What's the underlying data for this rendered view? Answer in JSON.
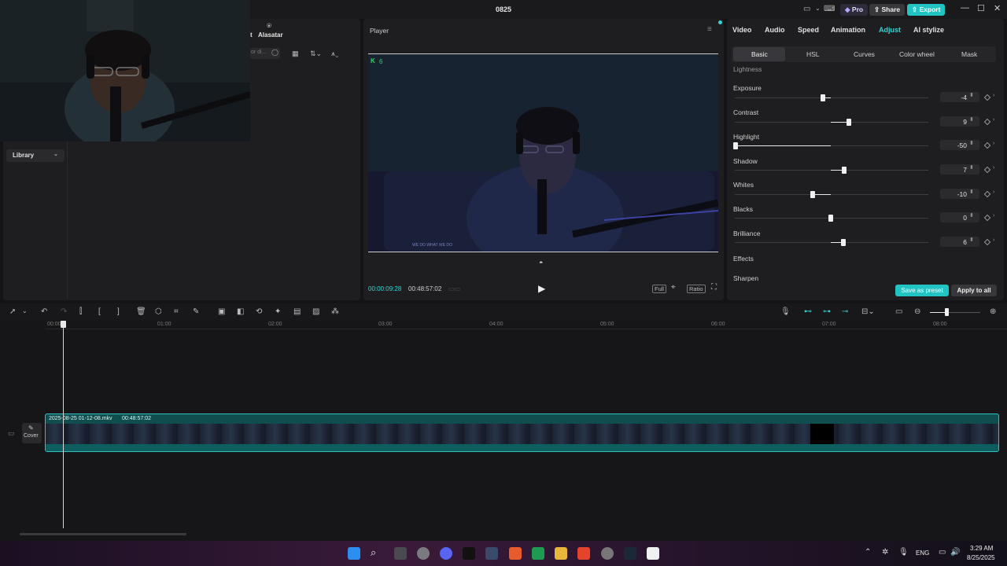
{
  "window": {
    "title": "0825",
    "pro_label": "Pro",
    "share_label": "Share",
    "export_label": "Export"
  },
  "media": {
    "tab_label": "Alasatar",
    "search_placeholder": "or di...",
    "library_label": "Library",
    "partial_tab": "t"
  },
  "player": {
    "title": "Player",
    "marker_count": "6",
    "current_time": "00:00:09:28",
    "total_time": "00:48:57:02",
    "full_label": "Full",
    "ratio_label": "Ratio",
    "watermark_text": "WE DO WHAT WE DO"
  },
  "adjust": {
    "tabs": [
      "Video",
      "Audio",
      "Speed",
      "Animation",
      "Adjust",
      "AI stylize"
    ],
    "active_tab": "Adjust",
    "subtabs": [
      "Basic",
      "HSL",
      "Curves",
      "Color wheel",
      "Mask"
    ],
    "active_subtab": "Basic",
    "section_lightness": "Lightness",
    "params": [
      {
        "label": "Exposure",
        "value": "-4"
      },
      {
        "label": "Contrast",
        "value": "9"
      },
      {
        "label": "Highlight",
        "value": "-50"
      },
      {
        "label": "Shadow",
        "value": "7"
      },
      {
        "label": "Whites",
        "value": "-10"
      },
      {
        "label": "Blacks",
        "value": "0"
      },
      {
        "label": "Brilliance",
        "value": "6"
      }
    ],
    "section_effects": "Effects",
    "sharpen_label": "Sharpen",
    "save_preset_label": "Save as preset",
    "apply_all_label": "Apply to all"
  },
  "timeline": {
    "ruler": [
      "00:00",
      "01:00",
      "02:00",
      "03:00",
      "04:00",
      "05:00",
      "06:00",
      "07:00",
      "08:00"
    ],
    "clip_name": "2025-08-25 01-12-08.mkv",
    "clip_duration": "00:48:57:02",
    "cover_label": "Cover"
  },
  "taskbar": {
    "lang": "ENG",
    "time": "3:29 AM",
    "date": "8/25/2025"
  },
  "colors": {
    "accent": "#2fd6d6",
    "export_bg": "#22c3c3",
    "pro_bg": "#2d2a3a",
    "clip_bg": "#0f4d4f"
  }
}
